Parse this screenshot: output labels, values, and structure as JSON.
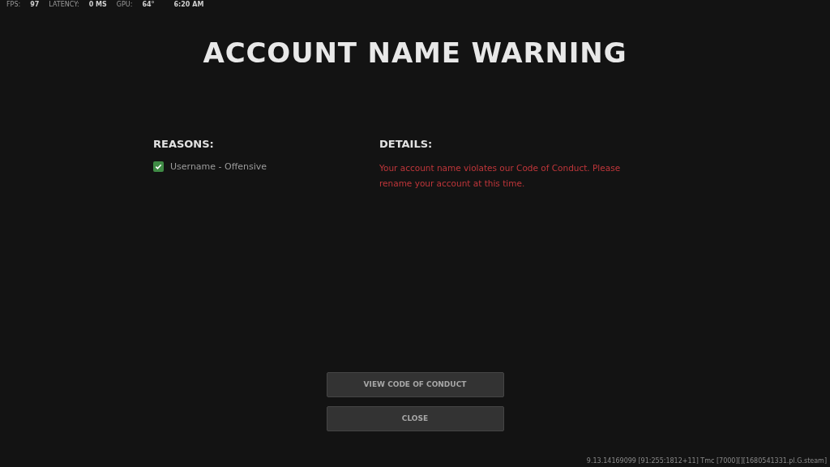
{
  "stats": [
    {
      "label": "FPS:",
      "value": "97"
    },
    {
      "label": "LATENCY:",
      "value": "0 MS"
    },
    {
      "label": "GPU:",
      "value": "64°"
    }
  ],
  "clock": "6:20 AM",
  "title": "ACCOUNT NAME WARNING",
  "reasons": {
    "heading": "REASONS:",
    "items": [
      {
        "label": "Username - Offensive",
        "checked": true
      }
    ]
  },
  "details": {
    "heading": "DETAILS:",
    "text": "Your account name violates our Code of Conduct. Please rename your account at this time."
  },
  "buttons": [
    "VIEW CODE OF CONDUCT",
    "CLOSE"
  ],
  "build": "9.13.14169099 [91:255:1812+11] Tmc [7000][][1680541331.pl.G.steam]"
}
